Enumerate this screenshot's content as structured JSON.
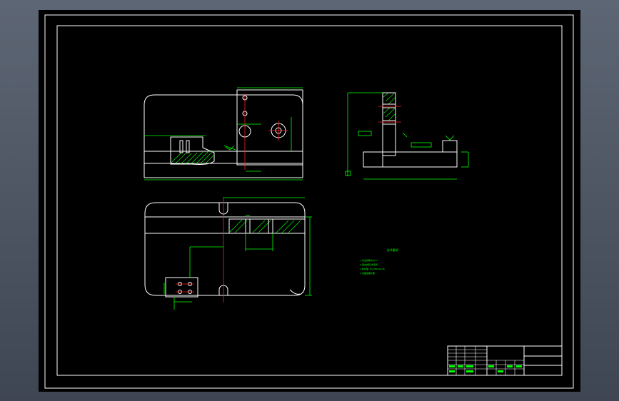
{
  "colors": {
    "frame": "#ffffff",
    "dimension": "#00ff00",
    "centerline": "#ff2020",
    "paper": "#000000",
    "app_background": "#4a5260"
  },
  "icons": [
    "surface-finish-icon",
    "datum-symbol-icon"
  ],
  "notes": {
    "title": "技术要求",
    "lines": [
      "1.未注倒角均为C1.",
      "2.锐边倒钝,去毛刺.",
      "3.热处理: 淬火HRC40-45.",
      "4.表面发黑处理."
    ]
  }
}
